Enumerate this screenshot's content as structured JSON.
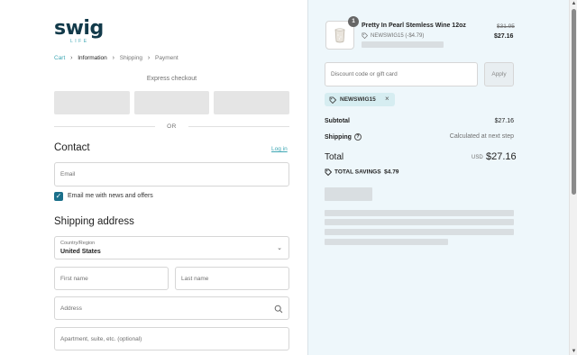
{
  "brand": {
    "word": "swig",
    "sub": "LIFE"
  },
  "breadcrumb": {
    "items": [
      "Cart",
      "Information",
      "Shipping",
      "Payment"
    ],
    "separator": "›"
  },
  "express": {
    "title": "Express checkout",
    "or": "OR"
  },
  "contact": {
    "heading": "Contact",
    "login": "Log in",
    "email_placeholder": "Email",
    "newsletter_label": "Email me with news and offers",
    "newsletter_checked": true
  },
  "shipping": {
    "heading": "Shipping address",
    "country_label": "Country/Region",
    "country_value": "United States",
    "first_name": "First name",
    "last_name": "Last name",
    "address": "Address",
    "apartment": "Apartment, suite, etc. (optional)"
  },
  "order": {
    "quantity": "1",
    "product_name": "Pretty In Pearl Stemless Wine 12oz",
    "product_discount": "NEWSWIG15 (-$4.79)",
    "price_original": "$31.95",
    "price_final": "$27.16",
    "discount_placeholder": "Discount code or gift card",
    "apply_label": "Apply",
    "applied_code": "NEWSWIG15",
    "subtotal_label": "Subtotal",
    "subtotal_value": "$27.16",
    "shipping_label": "Shipping",
    "shipping_value": "Calculated at next step",
    "total_label": "Total",
    "total_currency": "USD",
    "total_value": "$27.16",
    "savings_label": "TOTAL SAVINGS",
    "savings_value": "$4.79"
  },
  "colors": {
    "accent": "#3fa7b4",
    "checkbox": "#1a6f8a",
    "summary_bg": "#eef7fb",
    "brand_dark": "#123a4a"
  }
}
